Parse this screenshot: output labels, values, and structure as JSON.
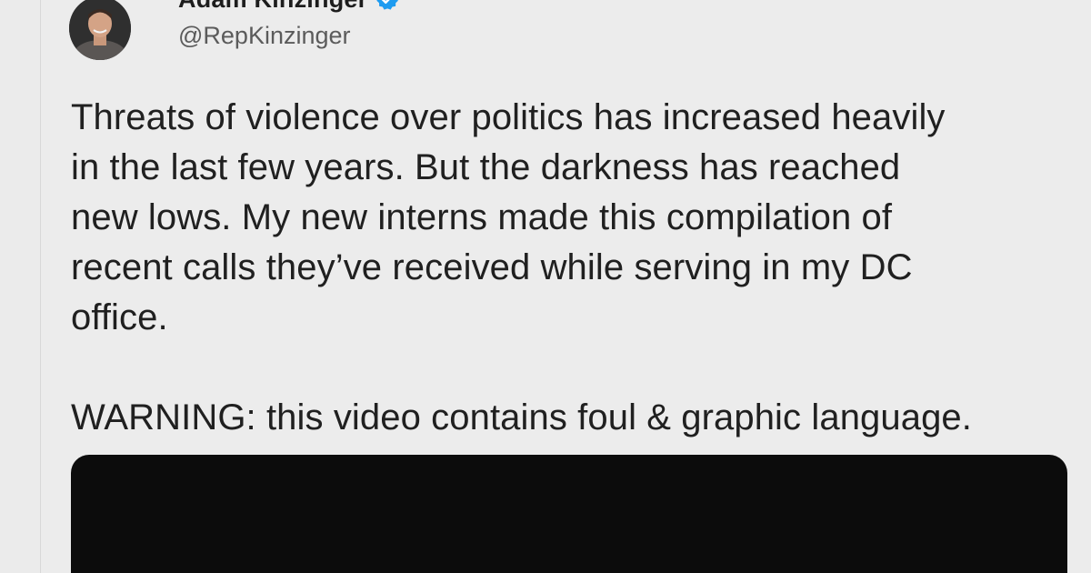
{
  "tweet": {
    "author": {
      "display_name": "Adam Kinzinger",
      "handle": "@RepKinzinger",
      "verified": true
    },
    "text": "Threats of violence over politics has increased heavily\nin the last few years. But the darkness has reached\nnew lows. My new interns made this compilation of\nrecent calls they’ve received while serving in my DC\noffice.\n\nWARNING: this video contains foul & graphic language."
  },
  "colors": {
    "background": "#ebebeb",
    "text": "#202020",
    "handle": "#5b5b5b",
    "verified": "#1d9bf0",
    "video": "#0c0c0c"
  },
  "icons": {
    "verified": "verified-badge-icon",
    "more": "more-options-icon"
  }
}
